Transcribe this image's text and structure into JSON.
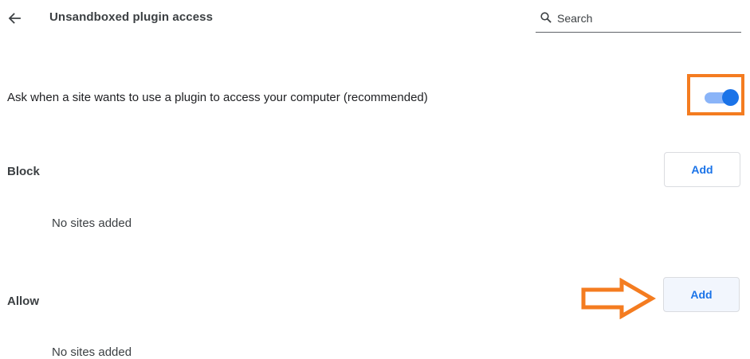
{
  "header": {
    "back_icon": "arrow-back-icon",
    "title": "Unsandboxed plugin access",
    "search": {
      "icon": "search-icon",
      "placeholder": "Search",
      "value": ""
    }
  },
  "ask_setting": {
    "label": "Ask when a site wants to use a plugin to access your computer (recommended)",
    "toggle_on": true
  },
  "sections": {
    "block": {
      "label": "Block",
      "add_label": "Add",
      "empty_text": "No sites added"
    },
    "allow": {
      "label": "Allow",
      "add_label": "Add",
      "empty_text": "No sites added"
    }
  },
  "annotations": {
    "highlight_color": "#f47c20"
  },
  "colors": {
    "accent": "#1a73e8",
    "toggle_track": "#8ab4f8",
    "text_primary": "#202124",
    "text_secondary": "#3c4043"
  }
}
